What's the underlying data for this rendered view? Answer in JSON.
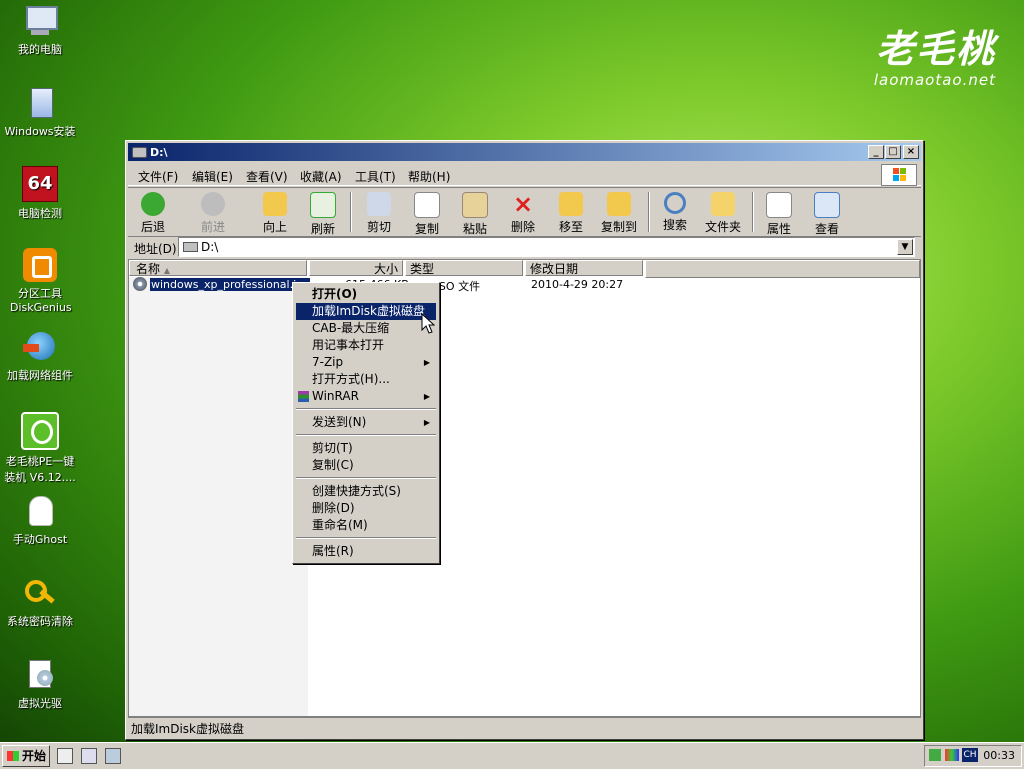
{
  "brand": {
    "logo": "老毛桃",
    "url": "laomaotao.net"
  },
  "desktop_icons": [
    {
      "label": "我的电脑"
    },
    {
      "label": "Windows安装"
    },
    {
      "label": "电脑检测",
      "badge": "64"
    },
    {
      "label": "分区工具DiskGenius"
    },
    {
      "label": "加载网络组件"
    },
    {
      "label": "老毛桃PE一键装机 V6.12...."
    },
    {
      "label": "手动Ghost"
    },
    {
      "label": "系统密码清除"
    },
    {
      "label": "虚拟光驱"
    }
  ],
  "window": {
    "title": "D:\\",
    "controls": [
      "_",
      "□",
      "×"
    ],
    "menu": [
      "文件(F)",
      "编辑(E)",
      "查看(V)",
      "收藏(A)",
      "工具(T)",
      "帮助(H)"
    ],
    "toolbar": [
      "后退",
      "前进",
      "向上",
      "刷新",
      "剪切",
      "复制",
      "粘贴",
      "删除",
      "移至",
      "复制到",
      "搜索",
      "文件夹",
      "属性",
      "查看"
    ],
    "address_label": "地址(D)",
    "address_value": "D:\\",
    "columns": [
      "名称",
      "大小",
      "类型",
      "修改日期"
    ],
    "file": {
      "name": "windows_xp_professional.iso",
      "size": "615,466 KB",
      "type": "UltraISO 文件",
      "date": "2010-4-29 20:27"
    },
    "status": "加载ImDisk虚拟磁盘"
  },
  "context_menu": [
    "打开(O)",
    "加载ImDisk虚拟磁盘",
    "CAB-最大压缩",
    "用记事本打开",
    "7-Zip",
    "打开方式(H)...",
    "WinRAR",
    "发送到(N)",
    "剪切(T)",
    "复制(C)",
    "创建快捷方式(S)",
    "删除(D)",
    "重命名(M)",
    "属性(R)"
  ],
  "taskbar": {
    "start": "开始",
    "clock": "00:33",
    "lang": "CH"
  }
}
